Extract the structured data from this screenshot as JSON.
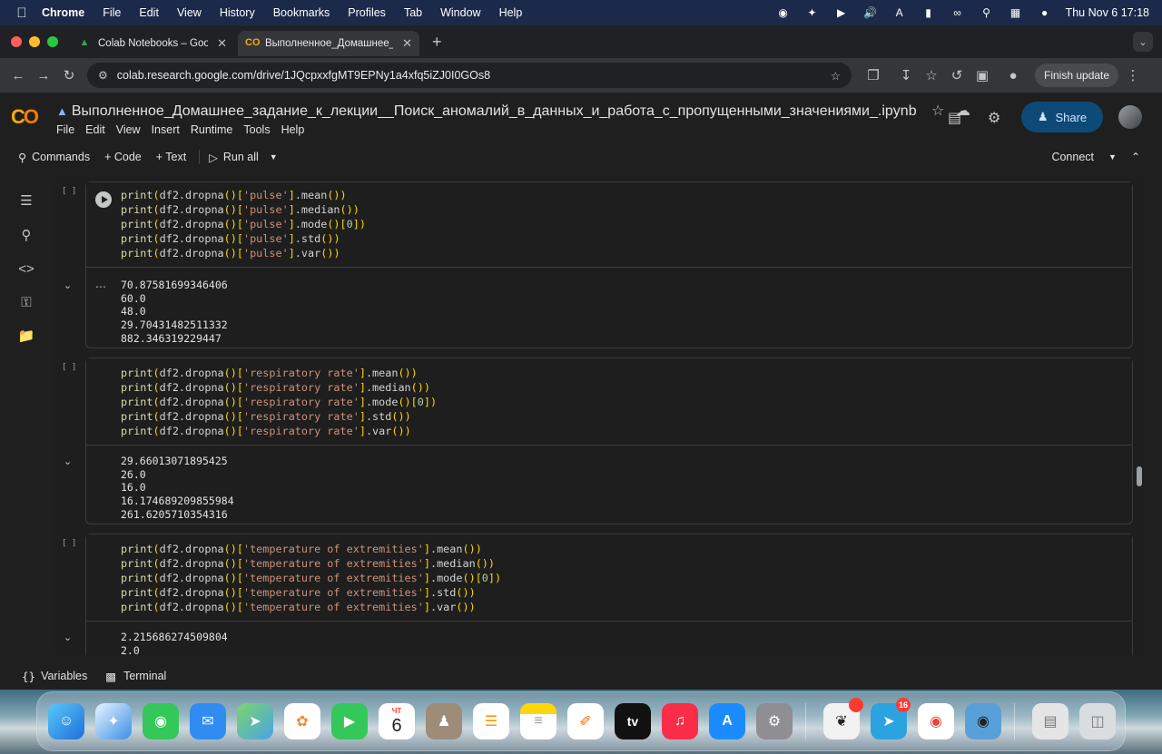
{
  "menubar": {
    "app": "Chrome",
    "items": [
      "File",
      "Edit",
      "View",
      "History",
      "Bookmarks",
      "Profiles",
      "Tab",
      "Window",
      "Help"
    ],
    "datetime": "Thu Nov 6  17:18"
  },
  "tabs": [
    {
      "title": "Colab Notebooks – Google Д",
      "active": false
    },
    {
      "title": "Выполненное_Домашнее_з",
      "active": true
    }
  ],
  "address": "colab.research.google.com/drive/1JQcpxxfgMT9EPNy1a4xfq5iZJ0I0GOs8",
  "finish_update": "Finish update",
  "notebook": {
    "title": "Выполненное_Домашнее_задание_к_лекции__Поиск_аномалий_в_данных_и_работа_с_пропущенными_значениями_.ipynb",
    "menu": [
      "File",
      "Edit",
      "View",
      "Insert",
      "Runtime",
      "Tools",
      "Help"
    ],
    "share": "Share"
  },
  "commands": {
    "commands": "Commands",
    "code": "+ Code",
    "text": "+ Text",
    "run_all": "Run all",
    "connect": "Connect"
  },
  "cells": [
    {
      "bracket": "[ ]",
      "col": "pulse",
      "output": [
        "70.87581699346406",
        "60.0",
        "48.0",
        "29.70431482511332",
        "882.346319229447"
      ]
    },
    {
      "bracket": "[ ]",
      "col": "respiratory rate",
      "output": [
        "29.66013071895425",
        "26.0",
        "16.0",
        "16.174689209855984",
        "261.6205710354316"
      ]
    },
    {
      "bracket": "[ ]",
      "col": "temperature of extremities",
      "output": [
        "2.215686274509804",
        "2.0"
      ]
    }
  ],
  "bottom": {
    "variables": "Variables",
    "terminal": "Terminal"
  },
  "dock": {
    "calendar_month": "ЧТ",
    "calendar_day": "6",
    "telegram_badge": "16",
    "appletv": "tv"
  }
}
